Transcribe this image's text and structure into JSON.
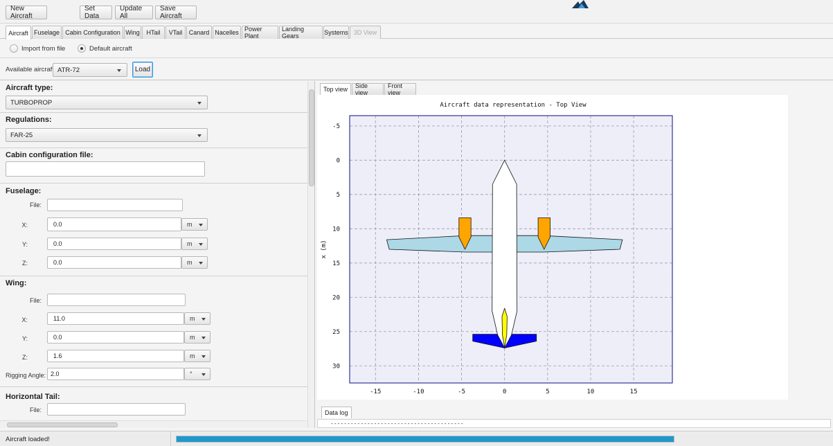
{
  "toolbar": {
    "new_aircraft": "New Aircraft",
    "set_data": "Set Data",
    "update_all": "Update All",
    "save_aircraft": "Save Aircraft"
  },
  "main_tabs": [
    {
      "label": "Aircraft",
      "state": "active"
    },
    {
      "label": "Fuselage",
      "state": "normal"
    },
    {
      "label": "Cabin Configuration",
      "state": "normal"
    },
    {
      "label": "Wing",
      "state": "normal"
    },
    {
      "label": "HTail",
      "state": "normal"
    },
    {
      "label": "VTail",
      "state": "normal"
    },
    {
      "label": "Canard",
      "state": "normal"
    },
    {
      "label": "Nacelles",
      "state": "normal"
    },
    {
      "label": "Power Plant",
      "state": "normal"
    },
    {
      "label": "Landing Gears",
      "state": "normal"
    },
    {
      "label": "Systems",
      "state": "normal"
    },
    {
      "label": "3D View",
      "state": "disabled"
    }
  ],
  "source": {
    "import_label": "Import from file",
    "default_label": "Default aircraft",
    "selected": "default"
  },
  "available": {
    "label": "Available aircrafts:",
    "value": "ATR-72",
    "load_label": "Load"
  },
  "form": {
    "aircraft_type": {
      "title": "Aircraft type:",
      "value": "TURBOPROP"
    },
    "regulations": {
      "title": "Regulations:",
      "value": "FAR-25"
    },
    "cabin_file": {
      "title": "Cabin configuration file:",
      "value": ""
    },
    "fuselage": {
      "title": "Fuselage:",
      "file_label": "File:",
      "file_value": "",
      "x_label": "X:",
      "x_value": "0.0",
      "x_unit": "m",
      "y_label": "Y:",
      "y_value": "0.0",
      "y_unit": "m",
      "z_label": "Z:",
      "z_value": "0.0",
      "z_unit": "m"
    },
    "wing": {
      "title": "Wing:",
      "file_label": "File:",
      "file_value": "",
      "x_label": "X:",
      "x_value": "11.0",
      "x_unit": "m",
      "y_label": "Y:",
      "y_value": "0.0",
      "y_unit": "m",
      "z_label": "Z:",
      "z_value": "1.6",
      "z_unit": "m",
      "rigging_label": "Rigging Angle:",
      "rigging_value": "2.0",
      "rigging_unit": "°"
    },
    "htail": {
      "title": "Horizontal Tail:",
      "file_label": "File:",
      "file_value": ""
    }
  },
  "view_tabs": [
    {
      "label": "Top view",
      "state": "active"
    },
    {
      "label": "Side view",
      "state": "normal"
    },
    {
      "label": "Front view",
      "state": "normal"
    }
  ],
  "chart_data": {
    "type": "scatter",
    "title": "Aircraft data representation - Top View",
    "xlabel": "",
    "ylabel": "x (m)",
    "xlim": [
      -18,
      19.5
    ],
    "ylim": [
      32.5,
      -6.5
    ],
    "xticks": [
      -15,
      -10,
      -5,
      0,
      5,
      10,
      15
    ],
    "yticks": [
      -5,
      0,
      5,
      10,
      15,
      20,
      25,
      30
    ],
    "grid": true,
    "colors": {
      "plot_bg": "#eeeef8",
      "frame": "#33339a",
      "wing": "#add8e6",
      "nacelle": "#ffa500",
      "htail": "#0000ff",
      "vtail": "#ffff00",
      "fuselage": "#ffffff"
    },
    "components": [
      {
        "name": "wing",
        "points": [
          [
            -13.7,
            11.6
          ],
          [
            -13.4,
            13.0
          ],
          [
            -4.5,
            13.4
          ],
          [
            0.0,
            13.4
          ],
          [
            4.5,
            13.4
          ],
          [
            13.4,
            13.0
          ],
          [
            13.7,
            11.6
          ],
          [
            4.5,
            11.0
          ],
          [
            0.0,
            11.0
          ],
          [
            -4.5,
            11.0
          ]
        ]
      },
      {
        "name": "nacelle-left",
        "points": [
          [
            -5.3,
            8.4
          ],
          [
            -3.9,
            8.4
          ],
          [
            -3.9,
            11.2
          ],
          [
            -4.6,
            13.0
          ],
          [
            -5.3,
            11.2
          ]
        ]
      },
      {
        "name": "nacelle-right",
        "points": [
          [
            3.9,
            8.4
          ],
          [
            5.3,
            8.4
          ],
          [
            5.3,
            11.2
          ],
          [
            4.6,
            13.0
          ],
          [
            3.9,
            11.2
          ]
        ]
      },
      {
        "name": "htail",
        "points": [
          [
            -3.7,
            25.4
          ],
          [
            3.7,
            25.4
          ],
          [
            3.7,
            26.4
          ],
          [
            0.0,
            27.4
          ],
          [
            -3.7,
            26.4
          ]
        ]
      },
      {
        "name": "fuselage",
        "points": [
          [
            0.0,
            0.0
          ],
          [
            1.4,
            3.5
          ],
          [
            1.45,
            22.0
          ],
          [
            0.8,
            25.5
          ],
          [
            0.0,
            27.4
          ],
          [
            -0.8,
            25.5
          ],
          [
            -1.45,
            22.0
          ],
          [
            -1.4,
            3.5
          ]
        ]
      },
      {
        "name": "vtail",
        "points": [
          [
            0.0,
            21.6
          ],
          [
            0.3,
            22.8
          ],
          [
            0.25,
            25.5
          ],
          [
            0.0,
            27.3
          ],
          [
            -0.25,
            25.5
          ],
          [
            -0.3,
            22.8
          ]
        ]
      }
    ]
  },
  "datalog": {
    "tab_label": "Data log",
    "text": "----------------------------------------"
  },
  "status": {
    "message": "Aircraft loaded!",
    "progress": 1.0
  }
}
